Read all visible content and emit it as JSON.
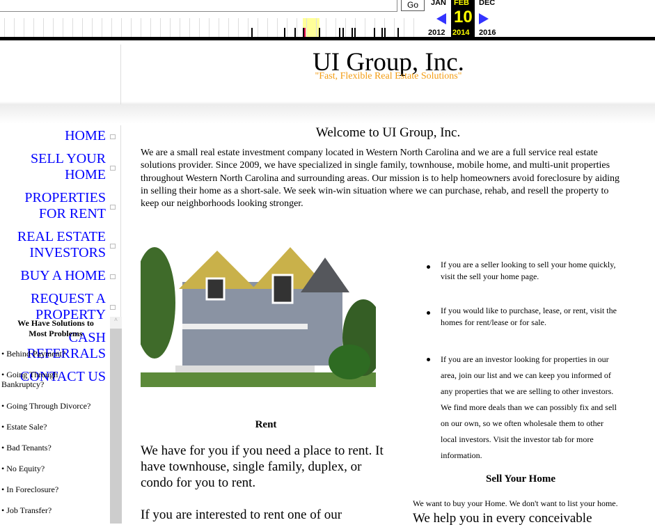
{
  "wayback": {
    "go_label": "Go",
    "months": {
      "prev": "JAN",
      "current": "FEB",
      "next": "DEC"
    },
    "day": "10",
    "years": {
      "prev": "2012",
      "current": "2014",
      "next": "2016"
    },
    "colors": {
      "highlight": "#ffff99",
      "current_bg": "#000000",
      "current_text": "#ffff00",
      "arrow": "#3333ff"
    }
  },
  "header": {
    "title": "UI Group, Inc.",
    "tagline": "\"Fast, Flexible Real Estate Solutions\""
  },
  "nav": [
    "HOME",
    "SELL YOUR HOME",
    "PROPERTIES FOR RENT",
    "REAL ESTATE INVESTORS",
    "BUY A HOME",
    "REQUEST A PROPERTY",
    "CASH",
    "REFERRALS",
    "CONTACT US"
  ],
  "solutions": {
    "heading": "We Have Solutions to Most Problems",
    "items": [
      "• Behind Payment?",
      "• Going Through Bankruptcy?",
      "• Going Through Divorce?",
      "• Estate Sale?",
      "• Bad Tenants?",
      "• No Equity?",
      "• In Foreclosure?",
      "• Job Transfer?"
    ]
  },
  "main": {
    "welcome": "Welcome to UI Group, Inc.",
    "intro": "We are a small real estate investment company located in Western North Carolina and we are a full service real estate solutions provider. Since 2009, we have specialized in single family, townhouse, mobile home, and multi-unit properties throughout Western North Carolina and surrounding areas. Our mission is to help homeowners avoid foreclosure by aiding in selling their home as a short-sale. We seek win-win situation where we can purchase, rehab, and resell the property to keep our neighborhoods looking stronger.",
    "bullets": [
      "If you are a seller looking to sell your home quickly, visit the sell your home page.",
      "If you would like to purchase, lease, or rent, visit the homes for rent/lease or for sale.",
      "If you are an investor looking for properties in our area, join our list and we can keep you informed of any properties that we are selling to other investors. We find more deals than we can possibly fix and sell on our own, so we often wholesale them to other local investors. Visit the investor tab for more information."
    ],
    "rent_heading": "Rent",
    "rent_text": "We have for you if you need a place to rent. It have townhouse, single family, duplex, or condo for you to rent.",
    "rent_text2": "If you are interested to rent one of our",
    "sell_heading": "Sell Your Home",
    "sell_text_small": "We want to buy your Home. We don't want to list your home.",
    "sell_text_large": "We help you in every conceivable"
  }
}
